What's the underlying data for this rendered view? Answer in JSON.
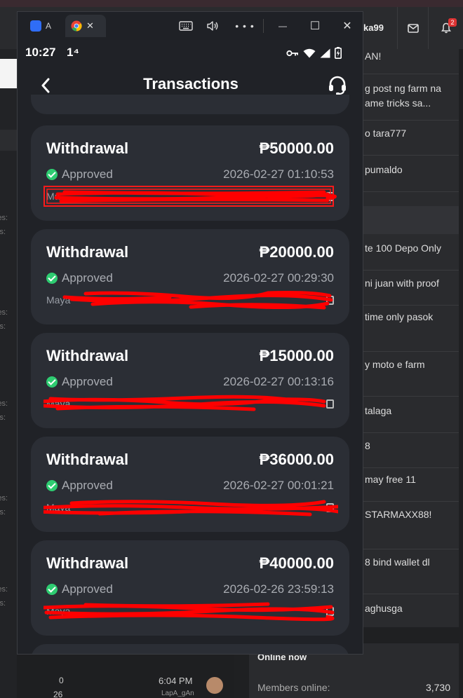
{
  "background": {
    "header_username": "ka99",
    "notification_count": "2",
    "sidebar_fragments": [
      "ies:",
      "ys:"
    ],
    "threads": [
      "AN!",
      "g post ng farm na ame tricks sa...",
      "o tara777",
      "pumaldo",
      "te 100 Depo Only",
      "ni juan with proof",
      "time only pasok",
      "y moto e farm",
      "talaga",
      "8",
      "may free 11",
      "STARMAXX88!",
      "8 bind wallet dl",
      "aghusga"
    ],
    "bottom_stats": {
      "count_top": "0",
      "count_bottom": "26",
      "time": "6:04 PM",
      "user": "LapA_gAn"
    },
    "online_now": {
      "title": "Online now",
      "members_label": "Members online:",
      "members_count": "3,730"
    }
  },
  "window": {
    "tabs": [
      {
        "label": "A",
        "icon": "app-icon"
      },
      {
        "label": "",
        "icon": "chrome-icon",
        "close": "✕"
      }
    ],
    "controls": {
      "minimize": "—",
      "maximize": "☐",
      "close": "✕"
    }
  },
  "statusbar": {
    "time": "10:27",
    "extra": "1⁴",
    "icons": [
      "vpn-key-icon",
      "wifi-icon",
      "signal-icon",
      "battery-charging-icon"
    ]
  },
  "header": {
    "title": "Transactions"
  },
  "transactions": [
    {
      "type": "Withdrawal",
      "amount": "₱50000.00",
      "status": "Approved",
      "date": "2026-02-27 01:10:53",
      "account": "Ma"
    },
    {
      "type": "Withdrawal",
      "amount": "₱20000.00",
      "status": "Approved",
      "date": "2026-02-27 00:29:30",
      "account": "Maya"
    },
    {
      "type": "Withdrawal",
      "amount": "₱15000.00",
      "status": "Approved",
      "date": "2026-02-27 00:13:16",
      "account": "Maya"
    },
    {
      "type": "Withdrawal",
      "amount": "₱36000.00",
      "status": "Approved",
      "date": "2026-02-27 00:01:21",
      "account": "Maya"
    },
    {
      "type": "Withdrawal",
      "amount": "₱40000.00",
      "status": "Approved",
      "date": "2026-02-26 23:59:13",
      "account": "Maya"
    }
  ],
  "colors": {
    "approved": "#2ecc71",
    "redaction": "#ff0000",
    "card": "#2b2e35"
  }
}
